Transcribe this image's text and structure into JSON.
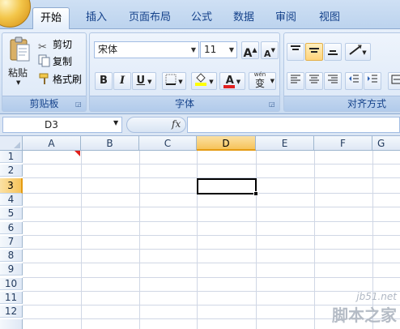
{
  "tabs": [
    {
      "label": "开始",
      "active": true
    },
    {
      "label": "插入",
      "active": false
    },
    {
      "label": "页面布局",
      "active": false
    },
    {
      "label": "公式",
      "active": false
    },
    {
      "label": "数据",
      "active": false
    },
    {
      "label": "审阅",
      "active": false
    },
    {
      "label": "视图",
      "active": false
    }
  ],
  "clipboard": {
    "label": "剪贴板",
    "paste": "粘贴",
    "cut": "剪切",
    "copy": "复制",
    "format_painter": "格式刷"
  },
  "font": {
    "label": "字体",
    "name": "宋体",
    "size": "11",
    "bold": "B",
    "italic": "I",
    "underline": "U",
    "grow": "A",
    "shrink": "A",
    "font_color_glyph": "A",
    "phonetic": "wén",
    "phonetic_char": "变"
  },
  "alignment": {
    "label": "对齐方式"
  },
  "formula_bar": {
    "name_box": "D3",
    "fx": "fx",
    "content": ""
  },
  "sheet": {
    "columns": [
      "A",
      "B",
      "C",
      "D",
      "E",
      "F",
      "G"
    ],
    "rows": [
      "1",
      "2",
      "3",
      "4",
      "5",
      "6",
      "7",
      "8",
      "9",
      "10",
      "11",
      "12"
    ],
    "active_cell": "D3",
    "active_column": "D",
    "active_row": "3"
  },
  "watermark": {
    "url": "jb51.net",
    "name": "脚本之家"
  },
  "colors": {
    "accent_selected": "#f6c35a",
    "font_color_bar": "#e02020",
    "fill_color_bar": "#ffff00",
    "comment_indicator": "#e0201b"
  }
}
